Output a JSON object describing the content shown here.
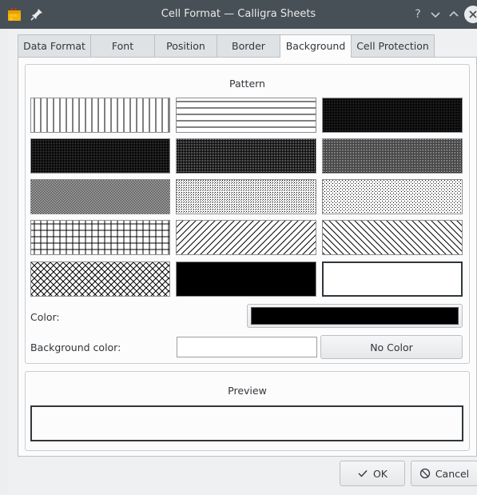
{
  "window": {
    "title": "Cell Format — Calligra Sheets",
    "help_glyph": "?",
    "minimize_glyph": "⌄",
    "maximize_glyph": "⌃"
  },
  "tabs": [
    {
      "label": "Data Format"
    },
    {
      "label": "Font"
    },
    {
      "label": "Position"
    },
    {
      "label": "Border"
    },
    {
      "label": "Background",
      "active": true
    },
    {
      "label": "Cell Protection"
    }
  ],
  "pattern_group": {
    "title": "Pattern",
    "patterns": [
      "vertical-lines",
      "horizontal-lines",
      "dense-1",
      "dense-2",
      "dense-3",
      "dense-4",
      "dense-5",
      "dense-6",
      "dense-7",
      "cross-grid",
      "diagonal-forward",
      "diagonal-backward",
      "diagonal-cross",
      "solid",
      "none"
    ],
    "color_label": "Color:",
    "color_value": "#000000",
    "background_color_label": "Background color:",
    "background_color_value": "#ffffff",
    "no_color_label": "No Color"
  },
  "preview_group": {
    "title": "Preview"
  },
  "buttons": {
    "ok_label": "OK",
    "cancel_label": "Cancel"
  },
  "colors": {
    "titlebar": "#475057",
    "accent": "#3daee9"
  }
}
